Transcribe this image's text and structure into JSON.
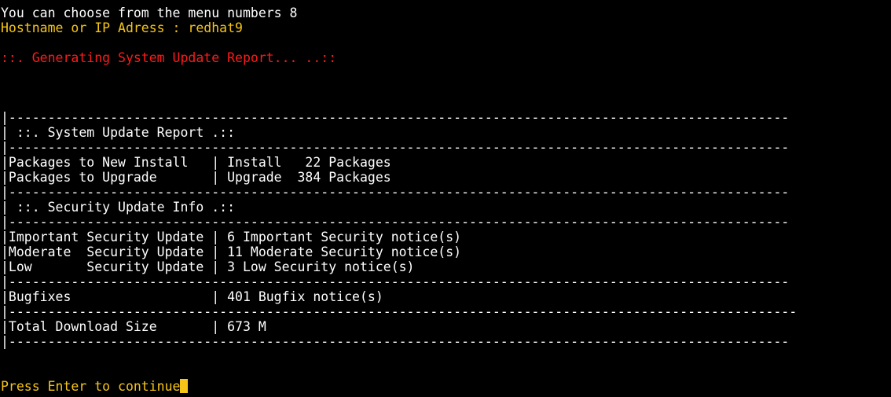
{
  "terminal": {
    "lines": {
      "l01": "You can choose from the menu numbers 8",
      "l02": "Hostname or IP Adress : redhat9",
      "l03": "::. Generating System Update Report... ..::",
      "l04": "|----------------------------------------------------------------------------------------------------",
      "l05": "| ::. System Update Report .::",
      "l06": "|----------------------------------------------------------------------------------------------------",
      "l07": "|Packages to New Install   | Install   22 Packages",
      "l08": "|Packages to Upgrade       | Upgrade  384 Packages",
      "l09": "|----------------------------------------------------------------------------------------------------",
      "l10": "| ::. Security Update Info .::",
      "l11": "|----------------------------------------------------------------------------------------------------",
      "l12": "|Important Security Update | 6 Important Security notice(s)",
      "l13": "|Moderate  Security Update | 11 Moderate Security notice(s)",
      "l14": "|Low       Security Update | 3 Low Security notice(s)",
      "l15": "|----------------------------------------------------------------------------------------------------",
      "l16": "|Bugfixes                  | 401 Bugfix notice(s)",
      "l17": "|-----------------------------------------------------------------------------------------------------",
      "l18": "|Total Download Size       | 673 M",
      "l19": "|----------------------------------------------------------------------------------------------------",
      "l20": "Press Enter to continue"
    },
    "colors": {
      "background": "#000000",
      "text": "#ffffff",
      "prompt": "#f5c518",
      "status": "#ff1a1a",
      "cursor": "#f5c518"
    }
  }
}
